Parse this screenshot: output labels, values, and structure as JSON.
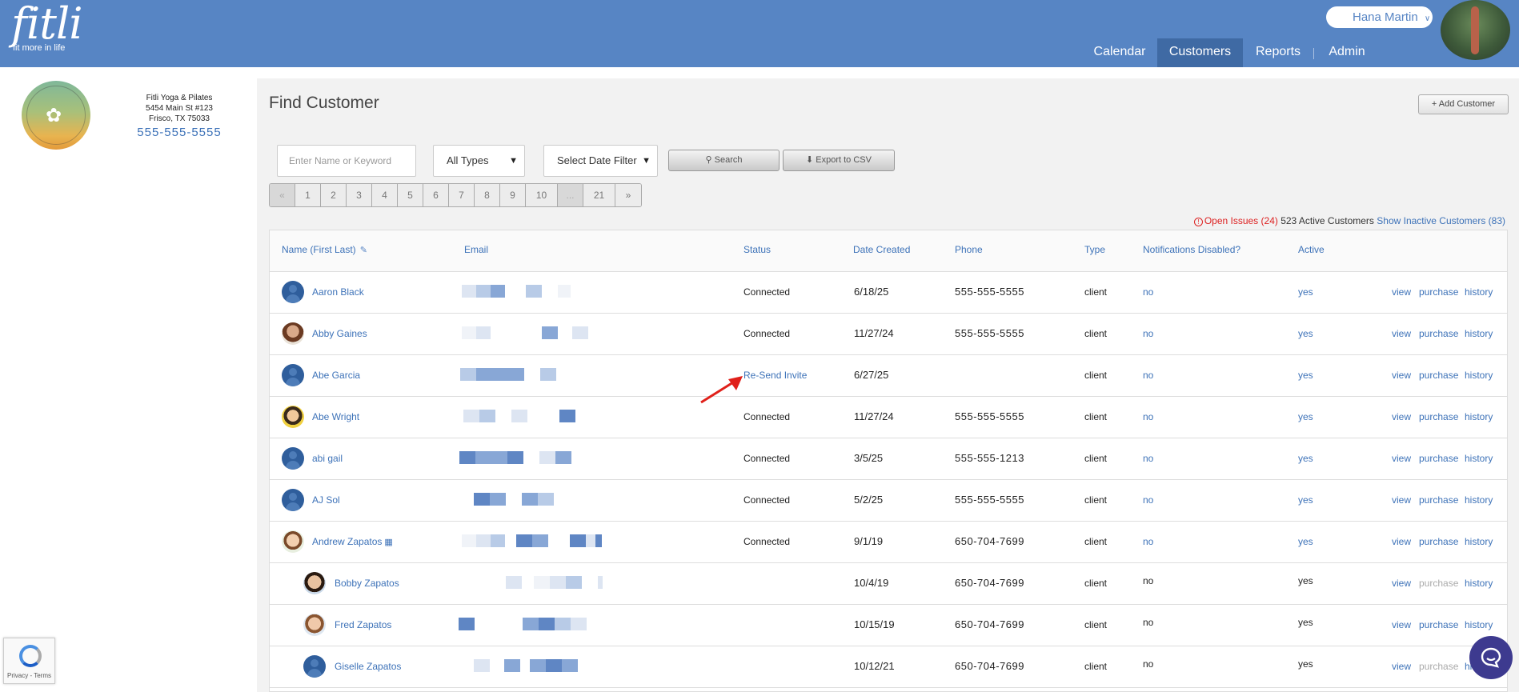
{
  "header": {
    "logo": "fitli",
    "tagline": "fit more in life",
    "user_name": "Hana Martin",
    "nav": [
      "Calendar",
      "Customers",
      "Reports",
      "Admin"
    ],
    "active_nav": "Customers"
  },
  "studio": {
    "name": "Fitli Yoga & Pilates",
    "address1": "5454 Main St #123",
    "address2": "Frisco, TX 75033",
    "phone": "555-555-5555"
  },
  "page": {
    "title": "Find Customer",
    "add_button": "+ Add Customer",
    "search_placeholder": "Enter Name or Keyword",
    "type_select": "All Types",
    "date_select": "Select Date Filter",
    "search_button": "Search",
    "export_button": "Export to CSV"
  },
  "pagination": [
    "«",
    "1",
    "2",
    "3",
    "4",
    "5",
    "6",
    "7",
    "8",
    "9",
    "10",
    "...",
    "21",
    "»"
  ],
  "summary": {
    "open_issues": "Open Issues (24)",
    "active_customers": "523 Active Customers",
    "show_inactive": "Show Inactive Customers (83)"
  },
  "table": {
    "columns": [
      "Name (First Last)",
      "Email",
      "Status",
      "Date Created",
      "Phone",
      "Type",
      "Notifications Disabled?",
      "Active"
    ],
    "actions": [
      "view",
      "purchase",
      "history"
    ],
    "rows": [
      {
        "name": "Aaron Black",
        "status": "Connected",
        "date": "6/18/25",
        "phone": "555-555-5555",
        "type": "client",
        "notif": "no",
        "active": "yes"
      },
      {
        "name": "Abby Gaines",
        "status": "Connected",
        "date": "11/27/24",
        "phone": "555-555-5555",
        "type": "client",
        "notif": "no",
        "active": "yes"
      },
      {
        "name": "Abe Garcia",
        "status": "Re-Send Invite",
        "date": "6/27/25",
        "phone": "",
        "type": "client",
        "notif": "no",
        "active": "yes"
      },
      {
        "name": "Abe Wright",
        "status": "Connected",
        "date": "11/27/24",
        "phone": "555-555-5555",
        "type": "client",
        "notif": "no",
        "active": "yes"
      },
      {
        "name": "abi gail",
        "status": "Connected",
        "date": "3/5/25",
        "phone": "555-555-1213",
        "type": "client",
        "notif": "no",
        "active": "yes"
      },
      {
        "name": "AJ Sol",
        "status": "Connected",
        "date": "5/2/25",
        "phone": "555-555-5555",
        "type": "client",
        "notif": "no",
        "active": "yes"
      },
      {
        "name": "Andrew Zapatos",
        "status": "Connected",
        "date": "9/1/19",
        "phone": "650-704-7699",
        "type": "client",
        "notif": "no",
        "active": "yes"
      },
      {
        "name": "Bobby Zapatos",
        "status": "",
        "date": "10/4/19",
        "phone": "650-704-7699",
        "type": "client",
        "notif": "no",
        "active": "yes"
      },
      {
        "name": "Fred Zapatos",
        "status": "",
        "date": "10/15/19",
        "phone": "650-704-7699",
        "type": "client",
        "notif": "no",
        "active": "yes"
      },
      {
        "name": "Giselle Zapatos",
        "status": "",
        "date": "10/12/21",
        "phone": "650-704-7699",
        "type": "client",
        "notif": "no",
        "active": "yes"
      }
    ]
  },
  "recaptcha": "Privacy - Terms",
  "colors": {
    "header": "#5785c4",
    "active_nav": "#3f6aa4",
    "link": "#3d72b8",
    "issues": "#dd2222",
    "chat": "#3d3a8f"
  }
}
